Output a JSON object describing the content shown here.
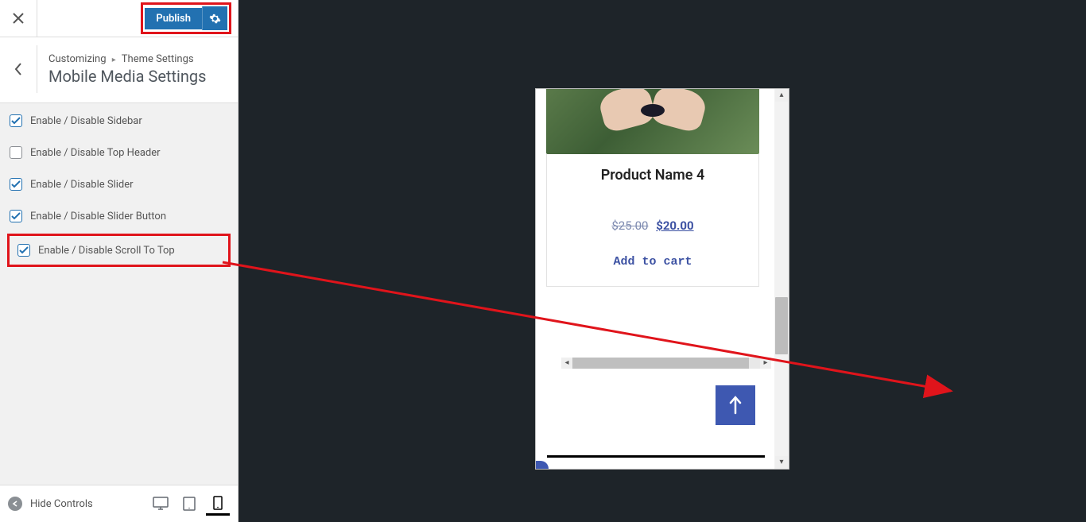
{
  "sidebar": {
    "publish_label": "Publish",
    "crumb1": "Customizing",
    "crumb2": "Theme Settings",
    "title": "Mobile Media Settings",
    "options": [
      {
        "label": "Enable / Disable Sidebar",
        "checked": true
      },
      {
        "label": "Enable / Disable Top Header",
        "checked": false
      },
      {
        "label": "Enable / Disable Slider",
        "checked": true
      },
      {
        "label": "Enable / Disable Slider Button",
        "checked": true
      },
      {
        "label": "Enable / Disable Scroll To Top",
        "checked": true
      }
    ],
    "hide_controls_label": "Hide Controls"
  },
  "preview": {
    "product_name": "Product Name 4",
    "price_old": "$25.00",
    "price_new": "$20.00",
    "add_to_cart_label": "Add to cart"
  }
}
